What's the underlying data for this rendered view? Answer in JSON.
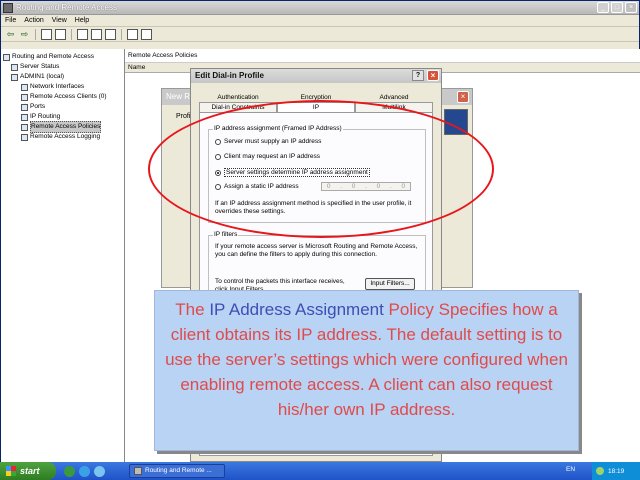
{
  "window": {
    "title": "Routing and Remote Access",
    "controls": [
      "_",
      "□",
      "×"
    ]
  },
  "menu": [
    "File",
    "Action",
    "View",
    "Help"
  ],
  "tree": {
    "items": [
      {
        "label": "Routing and Remote Access",
        "level": 0
      },
      {
        "label": "Server Status",
        "level": 1
      },
      {
        "label": "ADMIN1 (local)",
        "level": 1
      },
      {
        "label": "Network Interfaces",
        "level": 2
      },
      {
        "label": "Remote Access Clients (0)",
        "level": 2
      },
      {
        "label": "Ports",
        "level": 2
      },
      {
        "label": "IP Routing",
        "level": 2
      },
      {
        "label": "Remote Access Policies",
        "level": 2,
        "selected": true
      },
      {
        "label": "Remote Access Logging",
        "level": 2
      }
    ]
  },
  "right_pane": {
    "header": "Remote Access Policies",
    "column": "Name"
  },
  "back_dialog": {
    "title": "New Re",
    "label": "Profi"
  },
  "dialog": {
    "title": "Edit Dial-in Profile",
    "help": "?",
    "close": "×",
    "tabs_row1": [
      "Authentication",
      "Encryption",
      "Advanced"
    ],
    "tabs_row2": [
      "Dial-in Constraints",
      "IP",
      "Multilink"
    ],
    "ip_group": {
      "label": "IP address assignment (Framed IP Address)",
      "options": [
        "Server must supply an IP address",
        "Client may request an IP address",
        "Server settings determine IP address assignment",
        "Assign a static IP address"
      ],
      "selected_index": 2,
      "static_ip": [
        "0",
        ".",
        "0",
        ".",
        "0",
        ".",
        "0"
      ],
      "note": "If an IP address assignment method is specified in the user profile, it overrides these settings."
    },
    "filters_group": {
      "label": "IP filters",
      "text": "If your remote access server is Microsoft Routing and Remote Access, you can define the filters to apply during this connection.",
      "receive_text": "To control the packets this interface receives, click Input Filters.",
      "input_button": "Input Filters..."
    }
  },
  "callout": {
    "part1": "The ",
    "highlight": "IP Address Assignment",
    "part2": " Policy Specifies how a client obtains its IP address. The default setting is to use the server’s settings which were configured when enabling remote access. A client can also request his/her own IP address."
  },
  "taskbar": {
    "start": "start",
    "task": "Routing and Remote ...",
    "lang": "EN",
    "clock": "18:19"
  }
}
